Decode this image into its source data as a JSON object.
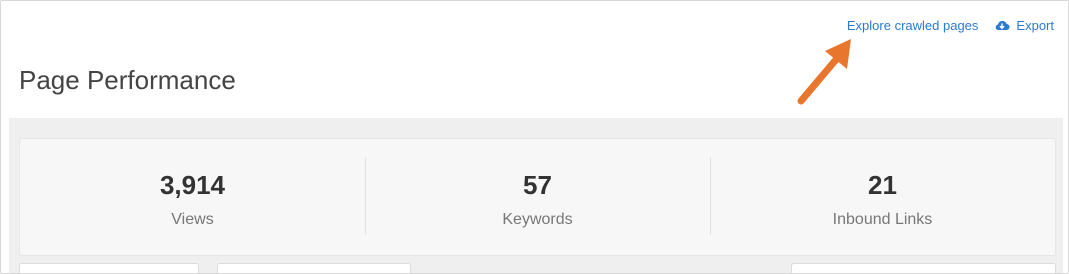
{
  "header": {
    "explore_label": "Explore crawled pages",
    "export_label": "Export",
    "export_icon": "cloud-download-icon",
    "link_color": "#2a7bd0"
  },
  "page": {
    "title": "Page Performance"
  },
  "stats": [
    {
      "value": "3,914",
      "label": "Views"
    },
    {
      "value": "57",
      "label": "Keywords"
    },
    {
      "value": "21",
      "label": "Inbound Links"
    }
  ],
  "annotation": {
    "arrow_color": "#e8762c"
  }
}
